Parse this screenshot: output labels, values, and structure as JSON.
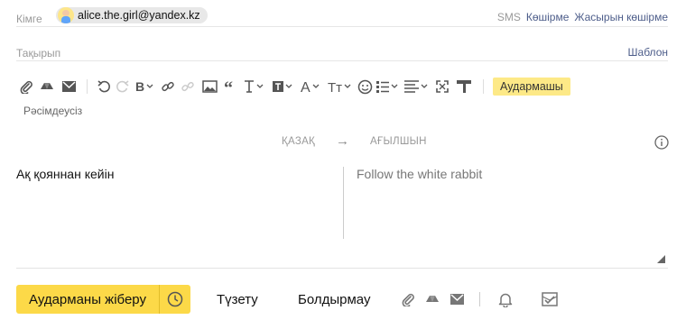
{
  "recipient": {
    "label": "Кімге",
    "email": "alice.the.girl@yandex.kz",
    "sms_label": "SMS",
    "copy_label": "Көшірме",
    "hidden_copy_label": "Жасырын көшірме"
  },
  "subject": {
    "label": "Тақырып",
    "template_label": "Шаблон"
  },
  "toolbar": {
    "translator_label": "Аудармашы",
    "format_label": "Рәсімдеусіз",
    "icons": [
      "attach-icon",
      "disk-icon",
      "mail-icon",
      "undo-icon",
      "redo-icon",
      "bold-icon",
      "link-icon",
      "unlink-icon",
      "image-icon",
      "quote-icon",
      "text-size-icon",
      "text-color-icon",
      "font-icon",
      "font-case-icon",
      "emoji-icon",
      "list-icon",
      "align-icon",
      "fullscreen-icon",
      "clear-format-icon"
    ]
  },
  "translation": {
    "source_lang": "ҚАЗАҚ",
    "arrow": "→",
    "target_lang": "АҒЫЛШЫН",
    "source_text": "Ақ қояннан кейін",
    "target_text": "Follow the white rabbit"
  },
  "actions": {
    "send_label": "Аударманы жіберу",
    "edit_label": "Түзету",
    "cancel_label": "Болдырмау"
  },
  "colors": {
    "accent": "#fcd948",
    "link": "#4d5d8a"
  }
}
